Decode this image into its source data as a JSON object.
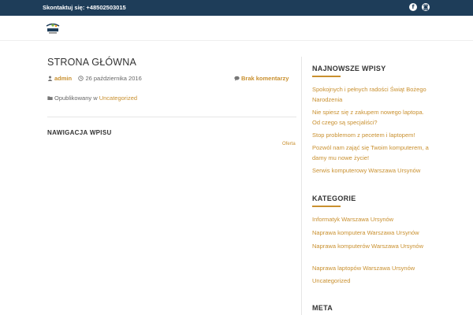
{
  "topbar": {
    "contact": "Skontaktuj się: +48502503015",
    "social": [
      {
        "icon": "facebook-icon",
        "glyph": "f"
      },
      {
        "icon": "instagram-icon",
        "glyph": "◙"
      }
    ]
  },
  "post": {
    "title": "STRONA GŁÓWNA",
    "author": "admin",
    "date": "26 października 2016",
    "comments": "Brak komentarzy",
    "published_prefix": "Opublikowany w",
    "category": "Uncategorized"
  },
  "navigation": {
    "heading": "NAWIGACJA WPISU",
    "next": "Oferta"
  },
  "sidebar": {
    "recent_title": "NAJNOWSZE WPISY",
    "recent_posts": [
      "Spokojnych i pełnych radości Świąt Bożego Narodzenia",
      "Nie spiesz się z zakupem nowego laptopa. Od czego są specjaliści?",
      "Stop problemom z pecetem i laptopem!",
      "Pozwól nam zająć się Twoim komputerem, a damy mu nowe życie!",
      "Serwis komputerowy Warszawa Ursynów"
    ],
    "categories_title": "KATEGORIE",
    "categories": [
      "Informatyk Warszawa Ursynów",
      "Naprawa komputera Warszawa Ursynów",
      "Naprawa komputerów Warszawa Ursynów",
      "Naprawa laptopów Warszawa Ursynów",
      "Uncategorized"
    ],
    "meta_title": "META"
  },
  "colors": {
    "topbar": "#1e3d59",
    "accent": "#c9902f"
  }
}
